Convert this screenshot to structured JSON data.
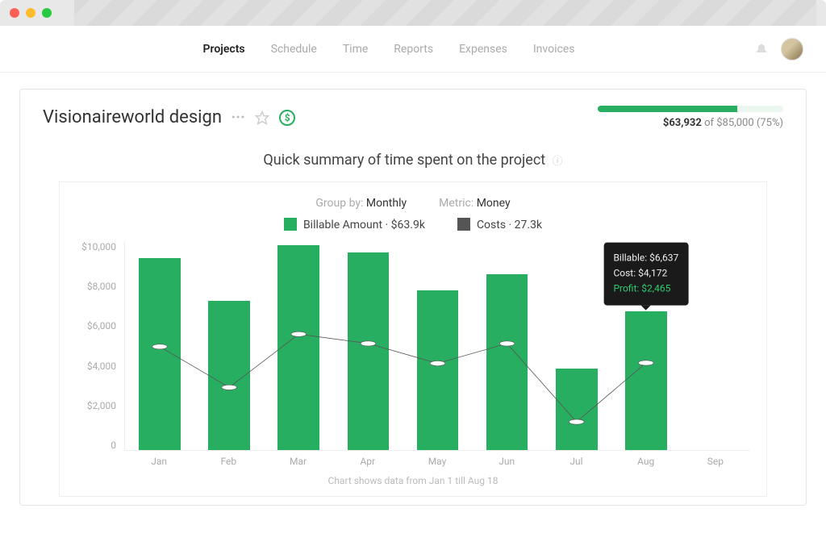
{
  "nav": {
    "items": [
      {
        "label": "Projects",
        "active": true
      },
      {
        "label": "Schedule",
        "active": false
      },
      {
        "label": "Time",
        "active": false
      },
      {
        "label": "Reports",
        "active": false
      },
      {
        "label": "Expenses",
        "active": false
      },
      {
        "label": "Invoices",
        "active": false
      }
    ]
  },
  "project": {
    "title": "Visionaireworld design"
  },
  "budget": {
    "spent_label": "$63,932",
    "of_label": "of",
    "total_label": "$85,000",
    "pct_label": "(75%)",
    "pct_value": 75
  },
  "chart_section": {
    "title": "Quick summary of time spent on the project",
    "group_by_label": "Group by:",
    "group_by_value": "Monthly",
    "metric_label": "Metric:",
    "metric_value": "Money",
    "legend_billable": "Billable Amount · $63.9k",
    "legend_costs": "Costs · 27.3k",
    "caption": "Chart shows data from Jan 1 till Aug 18"
  },
  "chart_data": {
    "type": "bar+line",
    "categories": [
      "Jan",
      "Feb",
      "Mar",
      "Apr",
      "May",
      "Jun",
      "Jul",
      "Aug",
      "Sep"
    ],
    "series": [
      {
        "name": "Billable Amount",
        "kind": "bar",
        "color": "#27ae60",
        "values": [
          9200,
          7150,
          9800,
          9450,
          7650,
          8400,
          3900,
          6637,
          null
        ]
      },
      {
        "name": "Costs",
        "kind": "line",
        "color": "#555",
        "values": [
          4950,
          3000,
          5550,
          5100,
          4150,
          5100,
          1350,
          4172,
          null
        ]
      }
    ],
    "ylim": [
      0,
      10000
    ],
    "yticks": [
      "$10,000",
      "$8,000",
      "$6,000",
      "$4,000",
      "$2,000",
      "0"
    ],
    "xlabel": "",
    "ylabel": ""
  },
  "tooltip": {
    "month_index": 7,
    "billable_label": "Billable:",
    "billable_value": "$6,637",
    "cost_label": "Cost:",
    "cost_value": "$4,172",
    "profit_label": "Profit:",
    "profit_value": "$2,465"
  }
}
